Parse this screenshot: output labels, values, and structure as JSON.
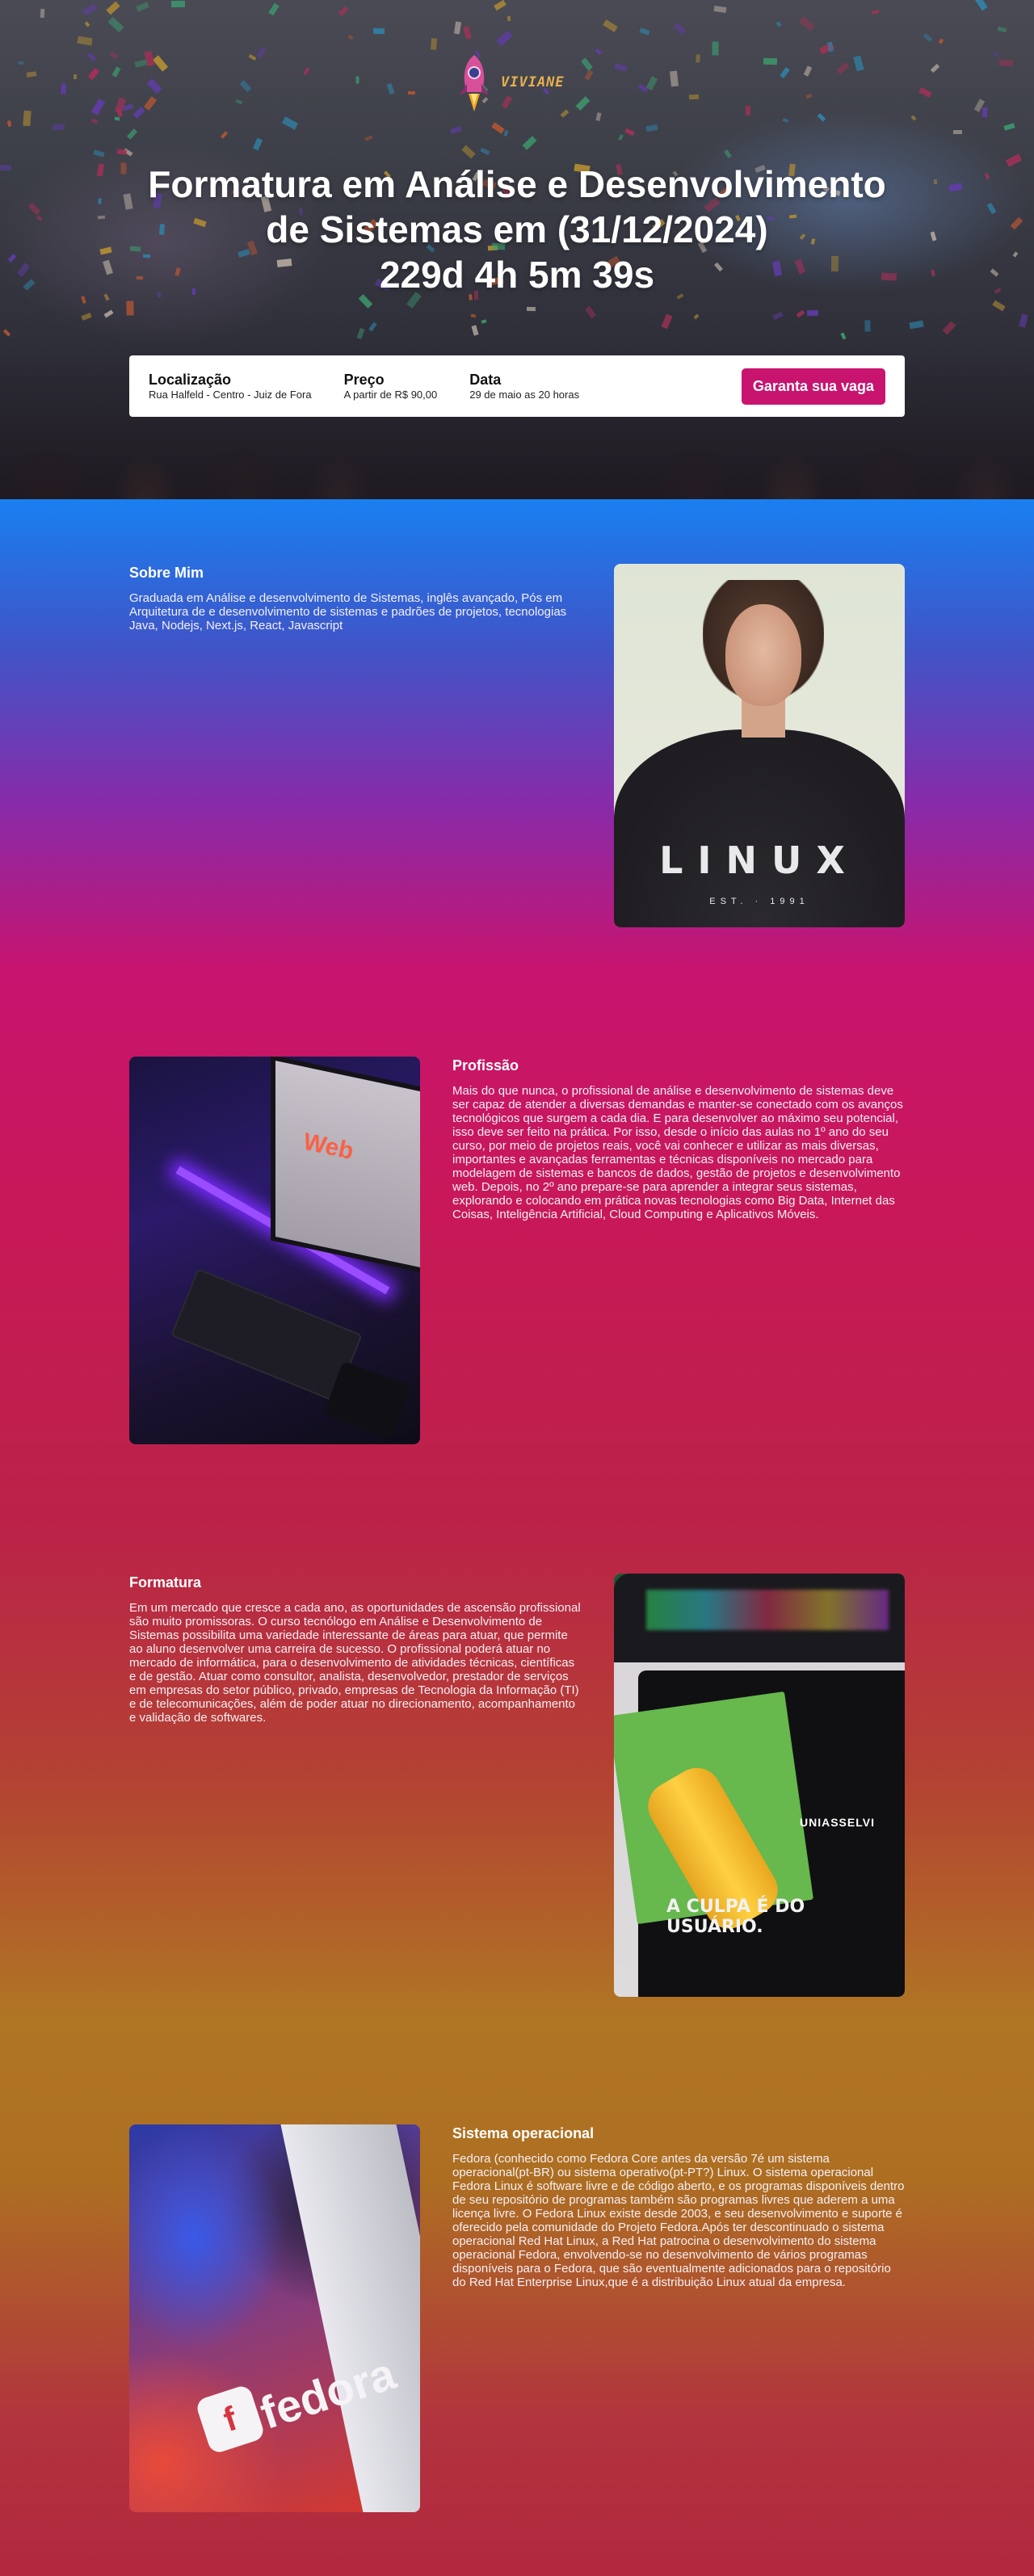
{
  "hero": {
    "logo_text": "VIVIANE",
    "title_line1": "Formatura em Análise e Desenvolvimento",
    "title_line2": "de Sistemas em (31/12/2024)",
    "countdown": "229d 4h 5m 39s"
  },
  "info": {
    "location_label": "Localização",
    "location_value": "Rua Halfeld - Centro - Juiz de Fora",
    "price_label": "Preço",
    "price_value": "A partir de R$ 90,00",
    "date_label": "Data",
    "date_value": "29 de maio as 20 horas",
    "cta_label": "Garanta sua vaga"
  },
  "sections": [
    {
      "title": "Sobre Mim",
      "text": "Graduada em Análise e desenvolvimento de Sistemas, inglês avançado, Pós em Arquitetura de e desenvolvimento de sistemas e padrões de projetos, tecnologias Java, Nodejs, Next.js, React, Javascript",
      "photo_shirt_text": "LINUX",
      "photo_shirt_sub": "EST. · 1991"
    },
    {
      "title": "Profissão",
      "text": "Mais do que nunca, o profissional de análise e desenvolvimento de sistemas deve ser capaz de atender a diversas demandas e manter-se conectado com os avanços tecnológicos que surgem a cada dia. E para desenvolver ao máximo seu potencial, isso deve ser feito na prática. Por isso, desde o início das aulas no 1º ano do seu curso, por meio de projetos reais, você vai conhecer e utilizar as mais diversas, importantes e avançadas ferramentas e técnicas disponíveis no mercado para modelagem de sistemas e bancos de dados, gestão de projetos e desenvolvimento web. Depois, no 2º ano prepare-se para aprender a integrar seus sistemas, explorando e colocando em prática novas tecnologias como Big Data, Internet das Coisas, Inteligência Artificial, Cloud Computing e Aplicativos Móveis."
    },
    {
      "title": "Formatura",
      "text": "Em um mercado que cresce a cada ano, as oportunidades de ascensão profissional são muito promissoras. O curso tecnólogo em Análise e Desenvolvimento de Sistemas possibilita uma variedade interessante de áreas para atuar, que permite ao aluno desenvolver uma carreira de sucesso. O profissional poderá atuar no mercado de informática, para o desenvolvimento de atividades técnicas, científicas e de gestão. Atuar como consultor, analista, desenvolvedor, prestador de serviços em empresas do setor público, privado, empresas de Tecnologia da Informação (TI) e de telecomunicações, além de poder atuar no direcionamento, acompanhamento e validação de softwares.",
      "photo_brand": "UNIASSELVI",
      "photo_slogan": "A CULPA É DO USUÁRIO."
    },
    {
      "title": "Sistema operacional",
      "text": "Fedora (conhecido como Fedora Core antes da versão 7é um sistema operacional(pt-BR) ou sistema operativo(pt-PT?) Linux. O sistema operacional Fedora Linux é software livre e de código aberto, e os programas disponíveis dentro de seu repositório de programas também são programas livres que aderem a uma licença livre. O Fedora Linux existe desde 2003, e seu desenvolvimento e suporte é oferecido pela comunidade do Projeto Fedora.Após ter descontinuado o sistema operacional Red Hat Linux, a Red Hat patrocina o desenvolvimento do sistema operacional Fedora, envolvendo-se no desenvolvimento de vários programas disponíveis para o Fedora, que são eventualmente adicionados para o repositório do Red Hat Enterprise Linux,que é a distribuição Linux atual da empresa.",
      "photo_word": "fedora"
    }
  ],
  "colors": {
    "accent": "#c8146f",
    "logo": "#e7b04d"
  }
}
